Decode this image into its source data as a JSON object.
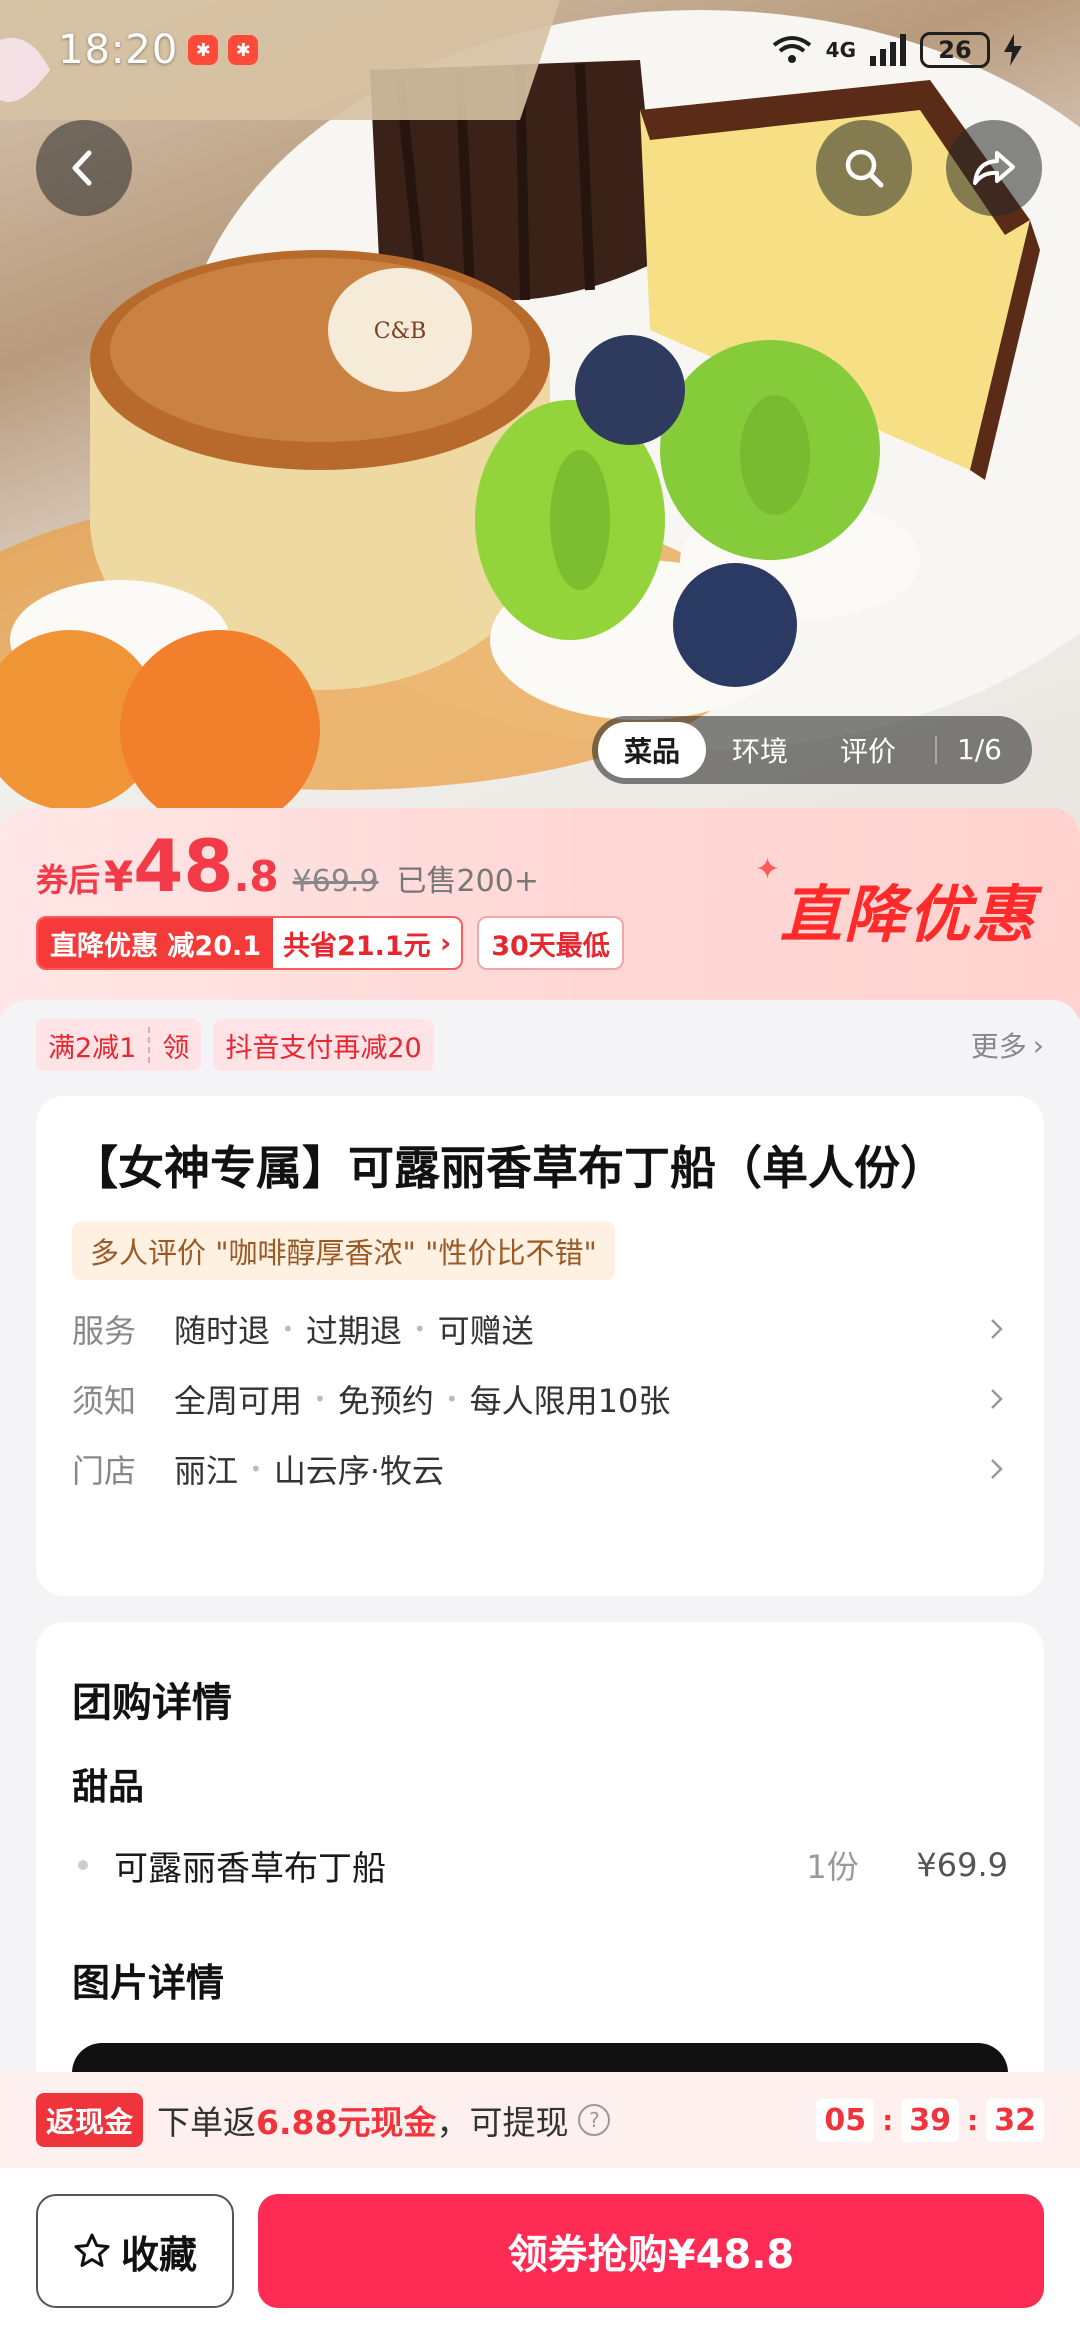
{
  "status_bar": {
    "time": "18:20",
    "network": "4G",
    "battery": "26"
  },
  "hero": {
    "photo_tabs": [
      "菜品",
      "环境",
      "评价"
    ],
    "photo_counter": "1/6",
    "plate_logo": "C&B"
  },
  "price": {
    "prefix": "券后",
    "currency": "¥",
    "integer": "48",
    "decimal": ".8",
    "original": "¥69.9",
    "sold": "已售200+",
    "tag_direct": "直降优惠",
    "tag_minus": "减20.1",
    "tag_save": "共省21.1元",
    "tag_lowest": "30天最低",
    "promo_label": "直降优惠"
  },
  "coupons": {
    "split_left": "满2减1",
    "split_right": "领",
    "douyin_pay": "抖音支付再减20",
    "more": "更多"
  },
  "product": {
    "title": "【女神专属】可露丽香草布丁船（单人份）",
    "review_tag": "多人评价 \"咖啡醇厚香浓\" \"性价比不错\"",
    "rows": [
      {
        "key": "服务",
        "values": [
          "随时退",
          "过期退",
          "可赠送"
        ]
      },
      {
        "key": "须知",
        "values": [
          "全周可用",
          "免预约",
          "每人限用10张"
        ]
      },
      {
        "key": "门店",
        "values": [
          "丽江",
          "山云序·牧云"
        ]
      }
    ]
  },
  "detail": {
    "heading": "团购详情",
    "category": "甜品",
    "item_name": "可露丽香草布丁船",
    "item_qty": "1份",
    "item_price": "¥69.9",
    "pictures_heading": "图片详情"
  },
  "cashback": {
    "badge": "返现金",
    "text_before": "下单返",
    "amount": "6.88元现金",
    "text_after": "，可提现",
    "help": "?",
    "timer_h": "05",
    "timer_m": "39",
    "timer_s": "32"
  },
  "actions": {
    "favorite": "收藏",
    "buy": "领券抢购¥48.8"
  },
  "colors": {
    "accent": "#fe2c55",
    "price": "#f23a48",
    "promo": "#ff2a2a"
  }
}
